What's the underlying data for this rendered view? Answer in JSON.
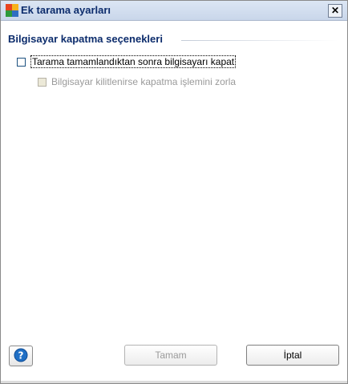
{
  "window": {
    "title": "Ek tarama ayarları",
    "close_glyph": "✕"
  },
  "section": {
    "title": "Bilgisayar kapatma seçenekleri"
  },
  "options": [
    {
      "label": "Tarama tamamlandıktan sonra bilgisayarı kapat",
      "checked": false,
      "enabled": true
    },
    {
      "label": "Bilgisayar kilitlenirse kapatma işlemini zorla",
      "checked": false,
      "enabled": false
    }
  ],
  "buttons": {
    "ok": "Tamam",
    "cancel": "İptal",
    "help_icon": "question-icon"
  },
  "colors": {
    "accent": "#0c2c6c",
    "help_blue": "#1f6fc5"
  }
}
